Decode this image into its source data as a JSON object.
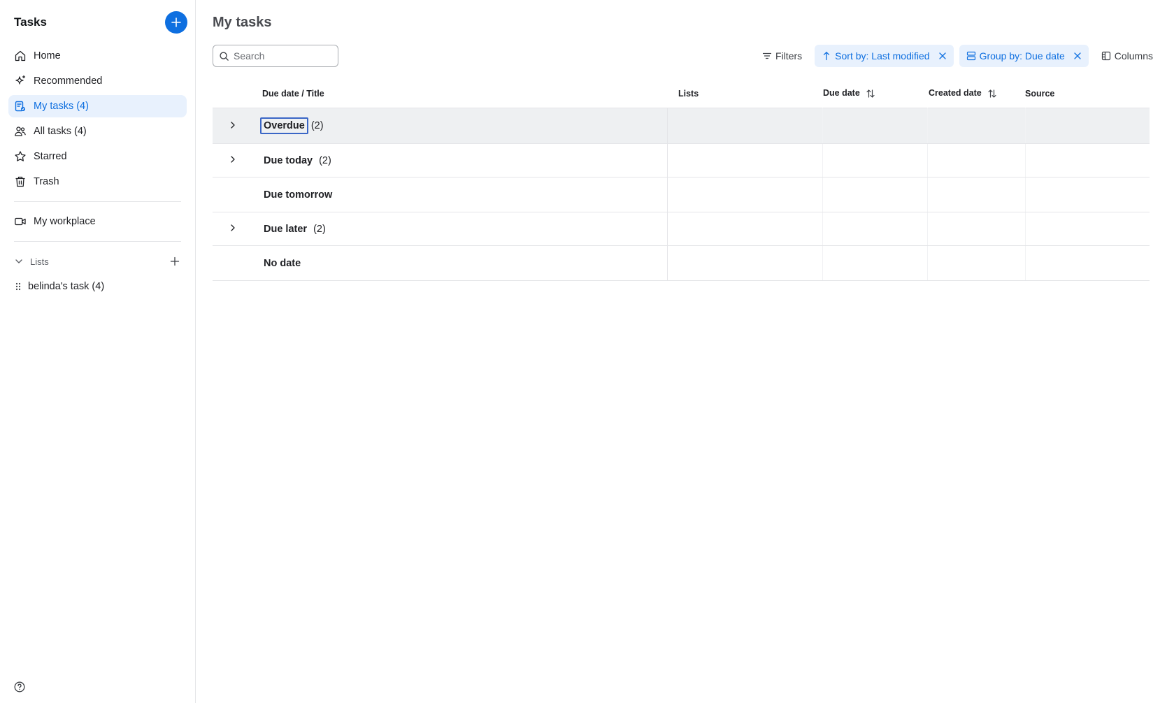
{
  "sidebar": {
    "title": "Tasks",
    "nav": [
      {
        "label": "Home",
        "icon": "home-icon"
      },
      {
        "label": "Recommended",
        "icon": "sparkle-icon"
      },
      {
        "label": "My tasks (4)",
        "icon": "my-tasks-icon",
        "active": true
      },
      {
        "label": "All tasks (4)",
        "icon": "people-icon"
      },
      {
        "label": "Starred",
        "icon": "star-icon"
      },
      {
        "label": "Trash",
        "icon": "trash-icon"
      }
    ],
    "workplace": {
      "label": "My workplace",
      "icon": "video-icon"
    },
    "lists_section": {
      "label": "Lists"
    },
    "lists": [
      {
        "label": "belinda's task (4)"
      }
    ]
  },
  "main": {
    "title": "My tasks",
    "search": {
      "placeholder": "Search",
      "value": ""
    },
    "toolbar": {
      "filters": "Filters",
      "sort_chip": "Sort by: Last modified",
      "group_chip": "Group by: Due date",
      "columns": "Columns"
    },
    "table": {
      "columns": [
        "Due date / Title",
        "Lists",
        "Due date",
        "Created date",
        "Source"
      ],
      "groups": [
        {
          "label": "Overdue",
          "count": "(2)",
          "expandable": true,
          "selected": true
        },
        {
          "label": "Due today",
          "count": "(2)",
          "expandable": true
        },
        {
          "label": "Due tomorrow",
          "count": "",
          "expandable": false
        },
        {
          "label": "Due later",
          "count": "(2)",
          "expandable": true
        },
        {
          "label": "No date",
          "count": "",
          "expandable": false
        }
      ]
    }
  },
  "colors": {
    "accent": "#0e6fe0",
    "chip_bg": "#e8f1fd",
    "selected_row": "#eef0f2"
  }
}
